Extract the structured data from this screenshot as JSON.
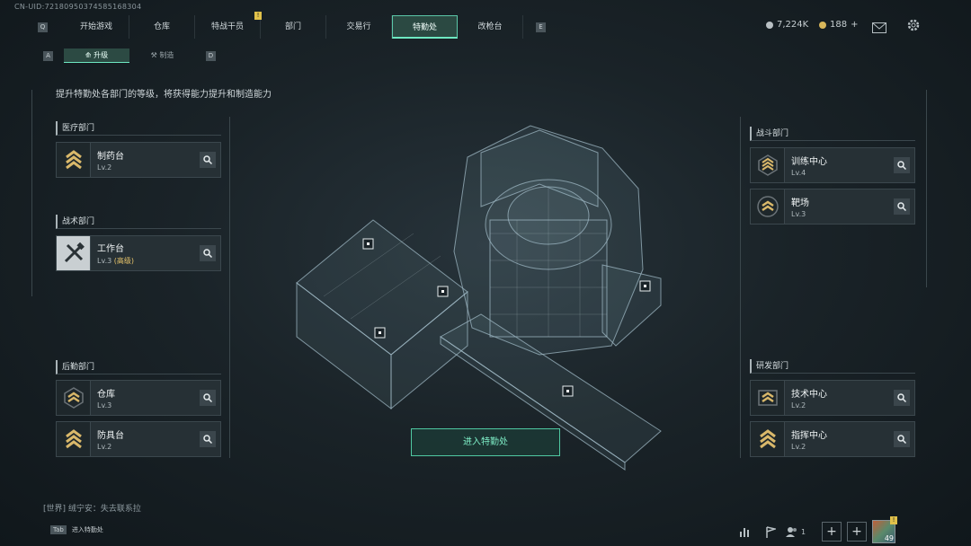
{
  "uid": "CN-UID:72180950374585168304",
  "nav": {
    "left_key": "Q",
    "right_key": "E",
    "tabs": [
      "开始游戏",
      "仓库",
      "特战干员",
      "部门",
      "交易行",
      "特勤处",
      "改枪台"
    ],
    "badge_tab_text": "!",
    "active": "特勤处"
  },
  "currency": {
    "coins": "7,224K",
    "bonds": "188",
    "plus": "+"
  },
  "subnav": {
    "left_key": "A",
    "right_key": "D",
    "tabs": [
      "升级",
      "制造"
    ],
    "active": "升级"
  },
  "description": "提升特勤处各部门的等级，将获得能力提升和制造能力",
  "departments": {
    "medical": {
      "title": "医疗部门",
      "items": [
        {
          "name": "制药台",
          "level": "Lv.2",
          "icon": "rank-chevron-icon"
        }
      ]
    },
    "tactical": {
      "title": "战术部门",
      "items": [
        {
          "name": "工作台",
          "level": "Lv.3",
          "level_extra": "(高级)",
          "icon": "wrench-hammer-icon"
        }
      ]
    },
    "logistics": {
      "title": "后勤部门",
      "items": [
        {
          "name": "仓库",
          "level": "Lv.3",
          "icon": "rank-chevron-icon"
        },
        {
          "name": "防具台",
          "level": "Lv.2",
          "icon": "rank-chevron-icon"
        }
      ]
    },
    "combat": {
      "title": "战斗部门",
      "items": [
        {
          "name": "训练中心",
          "level": "Lv.4",
          "icon": "rank-chevron-icon"
        },
        {
          "name": "靶场",
          "level": "Lv.3",
          "icon": "rank-emblem-icon"
        }
      ]
    },
    "research": {
      "title": "研发部门",
      "items": [
        {
          "name": "技术中心",
          "level": "Lv.2",
          "icon": "rank-chevron-icon"
        },
        {
          "name": "指挥中心",
          "level": "Lv.2",
          "icon": "rank-chevron-icon"
        }
      ]
    }
  },
  "enter_button": "进入特勤处",
  "chat": {
    "channel": "[世界]",
    "user": "绒宁安",
    "message": "：失去联系拉"
  },
  "tab_hint": {
    "key": "Tab",
    "label": "进入特勤处"
  },
  "bottom": {
    "friends_count": "1",
    "item_count": "49",
    "item_badge": "!"
  },
  "colors": {
    "accent": "#6ee8c1",
    "gold": "#e6c36a",
    "panel": "#263035"
  }
}
